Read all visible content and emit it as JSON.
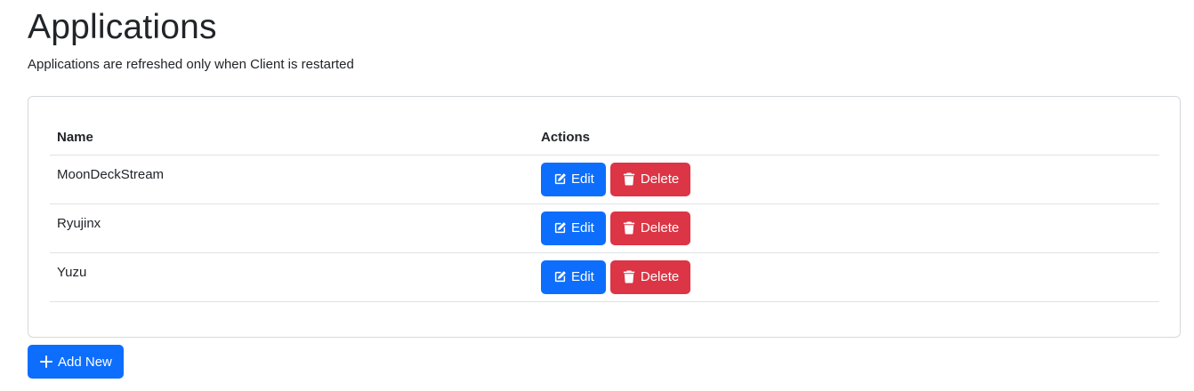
{
  "header": {
    "title": "Applications",
    "subtitle": "Applications are refreshed only when Client is restarted"
  },
  "table": {
    "columns": [
      "Name",
      "Actions"
    ],
    "rows": [
      {
        "name": "MoonDeckStream"
      },
      {
        "name": "Ryujinx"
      },
      {
        "name": "Yuzu"
      }
    ],
    "edit_label": "Edit",
    "delete_label": "Delete"
  },
  "add_new_label": "Add New",
  "colors": {
    "primary": "#0d6efd",
    "danger": "#dc3545",
    "border": "#dee2e6",
    "text": "#212529"
  },
  "icons": {
    "edit": "pencil-square-icon",
    "delete": "trash-icon",
    "add": "plus-icon"
  }
}
